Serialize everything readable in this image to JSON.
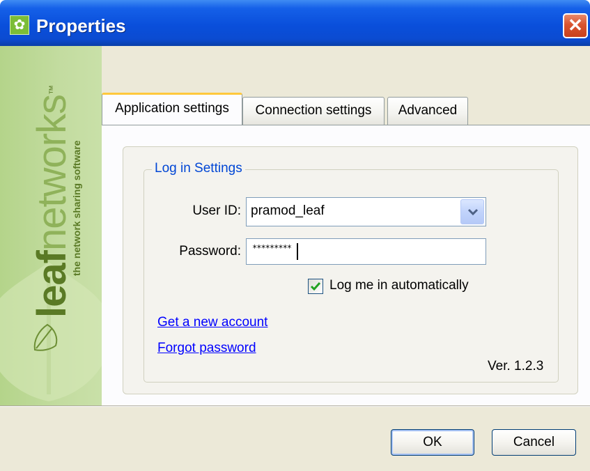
{
  "window": {
    "title": "Properties",
    "close_glyph": "✕",
    "icon": "leafnetworks-app-icon"
  },
  "brand": {
    "name_part1": "leaf",
    "name_part2": "networks",
    "trademark": "™",
    "tagline": "the network sharing software",
    "accent_color": "#7cbd37"
  },
  "tabs": [
    {
      "label": "Application settings",
      "active": true
    },
    {
      "label": "Connection settings",
      "active": false
    },
    {
      "label": "Advanced",
      "active": false
    }
  ],
  "login": {
    "group_title": "Log in Settings",
    "user_id_label": "User ID:",
    "user_id_value": "pramod_leaf",
    "password_label": "Password:",
    "password_value": "*********",
    "auto_login_label": "Log me in automatically",
    "auto_login_checked": true
  },
  "links": {
    "new_account": "Get a new account",
    "forgot_password": "Forgot password"
  },
  "version": "Ver. 1.2.3",
  "buttons": {
    "ok": "OK",
    "cancel": "Cancel"
  }
}
